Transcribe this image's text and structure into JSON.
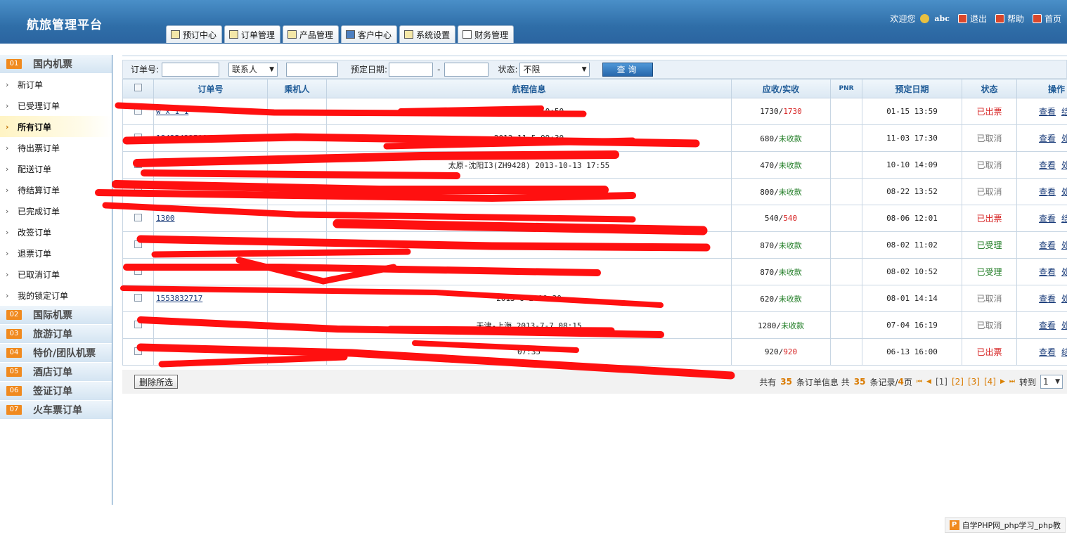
{
  "header": {
    "title": "航旅管理平台",
    "welcome": "欢迎您",
    "username": "abc",
    "links": [
      "退出",
      "帮助",
      "首页"
    ],
    "tabs": [
      "预订中心",
      "订单管理",
      "产品管理",
      "客户中心",
      "系统设置",
      "财务管理"
    ]
  },
  "sidebar": {
    "categories": [
      {
        "num": "01",
        "label": "国内机票"
      },
      {
        "num": "02",
        "label": "国际机票"
      },
      {
        "num": "03",
        "label": "旅游订单"
      },
      {
        "num": "04",
        "label": "特价/团队机票"
      },
      {
        "num": "05",
        "label": "酒店订单"
      },
      {
        "num": "06",
        "label": "签证订单"
      },
      {
        "num": "07",
        "label": "火车票订单"
      }
    ],
    "items": [
      "新订单",
      "已受理订单",
      "所有订单",
      "待出票订单",
      "配送订单",
      "待结算订单",
      "已完成订单",
      "改签订单",
      "退票订单",
      "已取消订单",
      "我的锁定订单"
    ],
    "active_index": 2
  },
  "filter": {
    "order_no_label": "订单号:",
    "order_no_value": "",
    "contact_select": "联系人",
    "contact_value": "",
    "date_label": "预定日期:",
    "date_from": "",
    "date_sep": "-",
    "date_to": "",
    "status_label": "状态:",
    "status_select": "不限",
    "query_button": "查询"
  },
  "table": {
    "columns": [
      "订单号",
      "乘机人",
      "航程信息",
      "应收/实收",
      "PNR",
      "预定日期",
      "状态",
      "操作"
    ],
    "rows": [
      {
        "order": "",
        "sub": "w x 1 1",
        "passenger": "",
        "route": "2014-1-18 10:50",
        "recv": "1730",
        "paid": "1730",
        "paid_type": "red",
        "pnr": "",
        "date": "01-15 13:59",
        "status": "已出票",
        "status_type": "red",
        "ops": [
          "查看",
          "结"
        ]
      },
      {
        "order": "18435422599",
        "sub": "",
        "passenger": "",
        "route": "2013-11-5 09:30",
        "recv": "680",
        "paid": "未收款",
        "paid_type": "green",
        "pnr": "",
        "date": "11-03 17:30",
        "status": "已取消",
        "status_type": "gray",
        "ops": [
          "查看",
          "处"
        ]
      },
      {
        "order": "",
        "sub": "",
        "passenger": "",
        "route": "太原-沈阳I3(ZH9428) 2013-10-13 17:55",
        "recv": "470",
        "paid": "未收款",
        "paid_type": "green",
        "pnr": "",
        "date": "10-10 14:09",
        "status": "已取消",
        "status_type": "gray",
        "ops": [
          "查看",
          "处"
        ]
      },
      {
        "order": "",
        "sub": "",
        "passenger": "",
        "route": "",
        "recv": "800",
        "paid": "未收款",
        "paid_type": "green",
        "pnr": "",
        "date": "08-22 13:52",
        "status": "已取消",
        "status_type": "gray",
        "ops": [
          "查看",
          "处"
        ]
      },
      {
        "order": "",
        "sub": "1300",
        "passenger": "",
        "route": "",
        "recv": "540",
        "paid": "540",
        "paid_type": "red",
        "pnr": "",
        "date": "08-06 12:01",
        "status": "已出票",
        "status_type": "red",
        "ops": [
          "查看",
          "结"
        ]
      },
      {
        "order": "",
        "sub": "",
        "passenger": "",
        "route": "",
        "recv": "870",
        "paid": "未收款",
        "paid_type": "green",
        "pnr": "",
        "date": "08-02 11:02",
        "status": "已受理",
        "status_type": "green",
        "ops": [
          "查看",
          "处"
        ]
      },
      {
        "order": "",
        "sub": "",
        "passenger": "",
        "route": "",
        "recv": "870",
        "paid": "未收款",
        "paid_type": "green",
        "pnr": "",
        "date": "08-02 10:52",
        "status": "已受理",
        "status_type": "green",
        "ops": [
          "查看",
          "处"
        ]
      },
      {
        "order": "",
        "sub": "1553832717",
        "passenger": "",
        "route": "2013-8-2 19:30",
        "recv": "620",
        "paid": "未收款",
        "paid_type": "green",
        "pnr": "",
        "date": "08-01 14:14",
        "status": "已取消",
        "status_type": "gray",
        "ops": [
          "查看",
          "处"
        ]
      },
      {
        "order": "",
        "sub": "",
        "passenger": "",
        "route": "天津-上海 2013-7-7 08:15",
        "recv": "1280",
        "paid": "未收款",
        "paid_type": "green",
        "pnr": "",
        "date": "07-04 16:19",
        "status": "已取消",
        "status_type": "gray",
        "ops": [
          "查看",
          "处"
        ]
      },
      {
        "order": "",
        "sub": "",
        "passenger": "",
        "route": "07:35",
        "recv": "920",
        "paid": "920",
        "paid_type": "red",
        "pnr": "",
        "date": "06-13 16:00",
        "status": "已出票",
        "status_type": "red",
        "ops": [
          "查看",
          "结"
        ]
      }
    ]
  },
  "footer": {
    "delete_button": "删除所选",
    "total_prefix": "共有",
    "total_count": "35",
    "total_mid": "条订单信息 共",
    "record_count": "35",
    "record_suffix": "条记录/",
    "page_count": "4",
    "page_suffix": "页",
    "pages": [
      "[1]",
      "[2]",
      "[3]",
      "[4]"
    ],
    "goto_label": "转到",
    "goto_value": "1"
  },
  "watermark": "自学PHP网_php学习_php教"
}
